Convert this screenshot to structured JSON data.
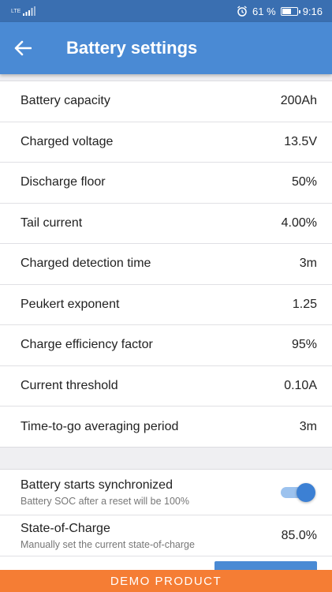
{
  "status_bar": {
    "network": "LTE",
    "battery_percent": "61 %",
    "time": "9:16",
    "icons": [
      "signal-icon",
      "alarm-icon",
      "battery-icon"
    ]
  },
  "app_bar": {
    "title": "Battery settings",
    "back_icon": "arrow-left-icon",
    "color": "#4a8ad4"
  },
  "settings": [
    {
      "label": "Battery capacity",
      "value": "200Ah"
    },
    {
      "label": "Charged voltage",
      "value": "13.5V"
    },
    {
      "label": "Discharge floor",
      "value": "50%"
    },
    {
      "label": "Tail current",
      "value": "4.00%"
    },
    {
      "label": "Charged detection time",
      "value": "3m"
    },
    {
      "label": "Peukert exponent",
      "value": "1.25"
    },
    {
      "label": "Charge efficiency factor",
      "value": "95%"
    },
    {
      "label": "Current threshold",
      "value": "0.10A"
    },
    {
      "label": "Time-to-go averaging period",
      "value": "3m"
    }
  ],
  "sync": {
    "label": "Battery starts synchronized",
    "description": "Battery SOC after a reset will be 100%",
    "enabled": true
  },
  "soc": {
    "label": "State-of-Charge",
    "description": "Manually set the current state-of-charge",
    "value": "85.0%"
  },
  "demo_banner": {
    "text": "DEMO PRODUCT",
    "color": "#f57d34"
  }
}
